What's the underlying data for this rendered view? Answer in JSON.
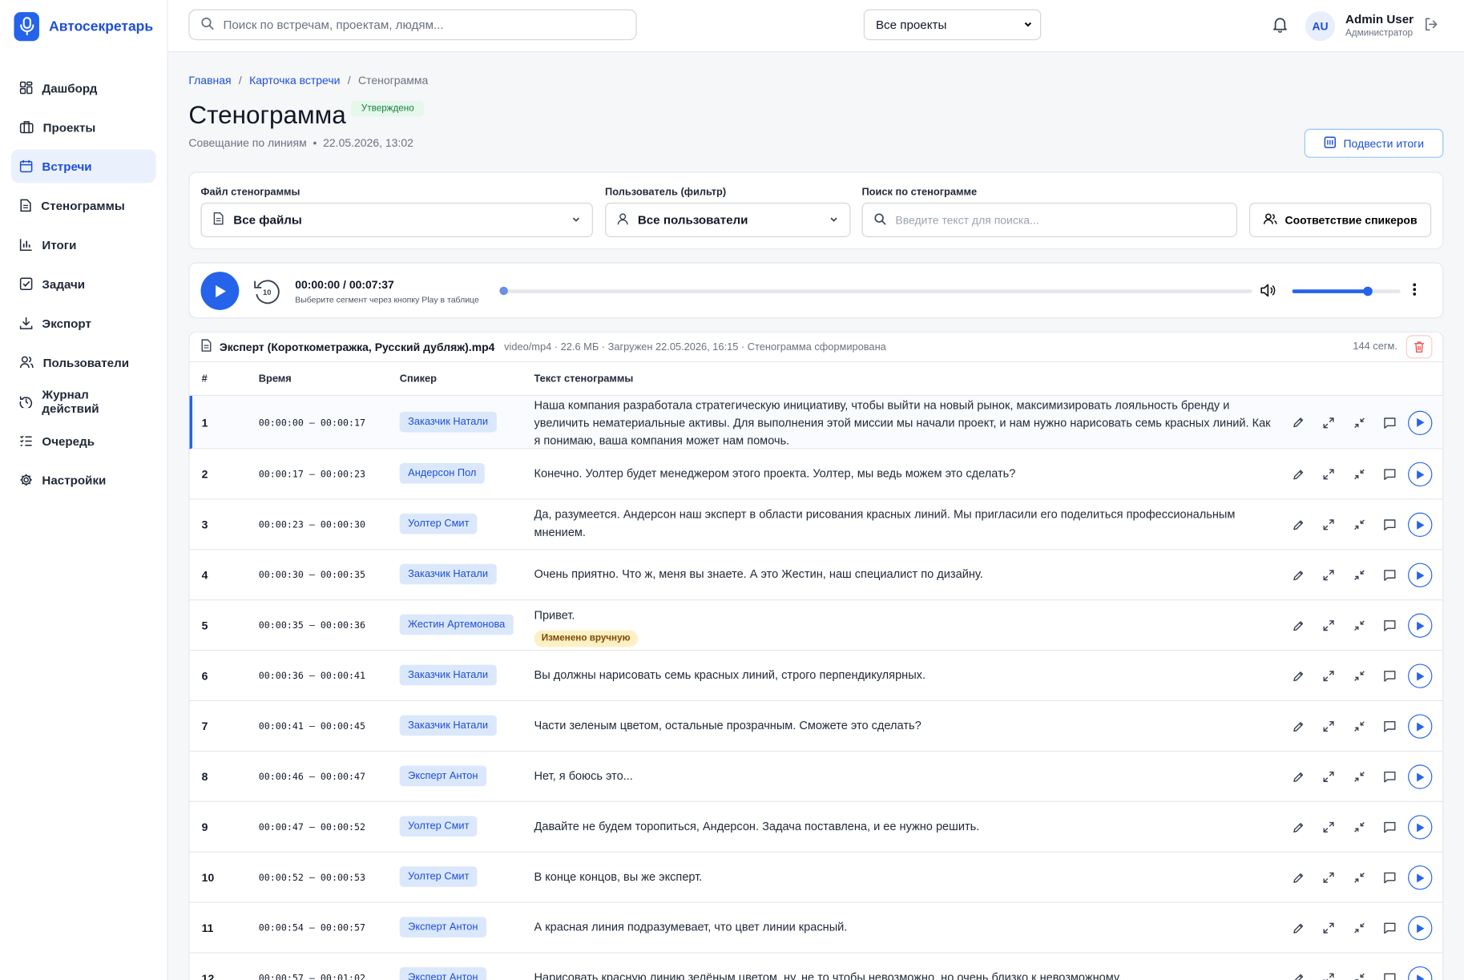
{
  "app": {
    "name": "Автосекретарь"
  },
  "sidebar": {
    "items": [
      {
        "label": "Дашборд",
        "icon": "grid-icon",
        "active": false
      },
      {
        "label": "Проекты",
        "icon": "briefcase-icon",
        "active": false
      },
      {
        "label": "Встречи",
        "icon": "calendar-icon",
        "active": true
      },
      {
        "label": "Стенограммы",
        "icon": "document-icon",
        "active": false
      },
      {
        "label": "Итоги",
        "icon": "bar-chart-icon",
        "active": false
      },
      {
        "label": "Задачи",
        "icon": "checkbox-icon",
        "active": false
      },
      {
        "label": "Экспорт",
        "icon": "download-icon",
        "active": false
      },
      {
        "label": "Пользователи",
        "icon": "users-icon",
        "active": false
      },
      {
        "label": "Журнал действий",
        "icon": "history-icon",
        "active": false
      },
      {
        "label": "Очередь",
        "icon": "list-check-icon",
        "active": false
      },
      {
        "label": "Настройки",
        "icon": "gear-icon",
        "active": false
      }
    ]
  },
  "topbar": {
    "search_placeholder": "Поиск по встречам, проектам, людям...",
    "project_select": "Все проекты",
    "user": {
      "initials": "AU",
      "name": "Admin User",
      "role": "Администратор"
    }
  },
  "breadcrumb": {
    "home": "Главная",
    "meeting": "Карточка встречи",
    "current": "Стенограмма",
    "sep": "/"
  },
  "page": {
    "title": "Стенограмма",
    "status": "Утверждено",
    "meeting_name": "Совещание по линиям",
    "dot": "•",
    "datetime": "22.05.2026, 13:02",
    "summarize_button": "Подвести итоги"
  },
  "filters": {
    "file_label": "Файл стенограммы",
    "file_value": "Все файлы",
    "user_label": "Пользователь (фильтр)",
    "user_value": "Все пользователи",
    "search_label": "Поиск по стенограмме",
    "search_placeholder": "Введите текст для поиска...",
    "speakers_button": "Соответствие спикеров"
  },
  "player": {
    "time": "00:00:00 / 00:07:37",
    "hint": "Выберите сегмент через кнопку Play в таблице",
    "rewind_seconds": "10",
    "progress": 0,
    "volume": 0.7
  },
  "file": {
    "name": "Эксперт (Короткометражка, Русский дубляж).mp4",
    "meta": "video/mp4 · 22.6 МБ · Загружен 22.05.2026, 16:15 · Стенограмма сформирована",
    "segments": "144 сегм."
  },
  "table": {
    "headers": {
      "num": "#",
      "time": "Время",
      "speaker": "Спикер",
      "text": "Текст стенограммы"
    },
    "edited_label": "Изменено вручную",
    "rows": [
      {
        "num": "1",
        "time": "00:00:00 – 00:00:17",
        "speaker": "Заказчик Натали",
        "text": "Наша компания разработала стратегическую инициативу, чтобы выйти на новый рынок, максимизировать лояльность бренду и увеличить нематериальные активы. Для выполнения этой миссии мы начали проект, и нам нужно нарисовать семь красных линий. Как я понимаю, ваша компания может нам помочь."
      },
      {
        "num": "2",
        "time": "00:00:17 – 00:00:23",
        "speaker": "Андерсон Пол",
        "text": "Конечно. Уолтер будет менеджером этого проекта. Уолтер, мы ведь можем это сделать?"
      },
      {
        "num": "3",
        "time": "00:00:23 – 00:00:30",
        "speaker": "Уолтер Смит",
        "text": "Да, разумеется. Андерсон наш эксперт в области рисования красных линий. Мы пригласили его поделиться профессиональным мнением."
      },
      {
        "num": "4",
        "time": "00:00:30 – 00:00:35",
        "speaker": "Заказчик Натали",
        "text": "Очень приятно. Что ж, меня вы знаете. А это Жестин, наш специалист по дизайну."
      },
      {
        "num": "5",
        "time": "00:00:35 – 00:00:36",
        "speaker": "Жестин Артемонова",
        "text": "Привет.",
        "edited": true
      },
      {
        "num": "6",
        "time": "00:00:36 – 00:00:41",
        "speaker": "Заказчик Натали",
        "text": "Вы должны нарисовать семь красных линий, строго перпендикулярных."
      },
      {
        "num": "7",
        "time": "00:00:41 – 00:00:45",
        "speaker": "Заказчик Натали",
        "text": "Части зеленым цветом, остальные прозрачным. Сможете это сделать?"
      },
      {
        "num": "8",
        "time": "00:00:46 – 00:00:47",
        "speaker": "Эксперт Антон",
        "text": "Нет, я боюсь это..."
      },
      {
        "num": "9",
        "time": "00:00:47 – 00:00:52",
        "speaker": "Уолтер Смит",
        "text": "Давайте не будем торопиться, Андерсон. Задача поставлена, и ее нужно решить."
      },
      {
        "num": "10",
        "time": "00:00:52 – 00:00:53",
        "speaker": "Уолтер Смит",
        "text": "В конце концов, вы же эксперт."
      },
      {
        "num": "11",
        "time": "00:00:54 – 00:00:57",
        "speaker": "Эксперт Антон",
        "text": "А красная линия подразумевает, что цвет линии красный."
      },
      {
        "num": "12",
        "time": "00:00:57 – 00:01:02",
        "speaker": "Эксперт Антон",
        "text": "Нарисовать красную линию зелёным цветом, ну, не то чтобы невозможно, но очень близко к невозможному."
      }
    ]
  },
  "colors": {
    "accent": "#2563eb",
    "badge_bg": "#dbe8fb",
    "approved": "#15803d"
  }
}
